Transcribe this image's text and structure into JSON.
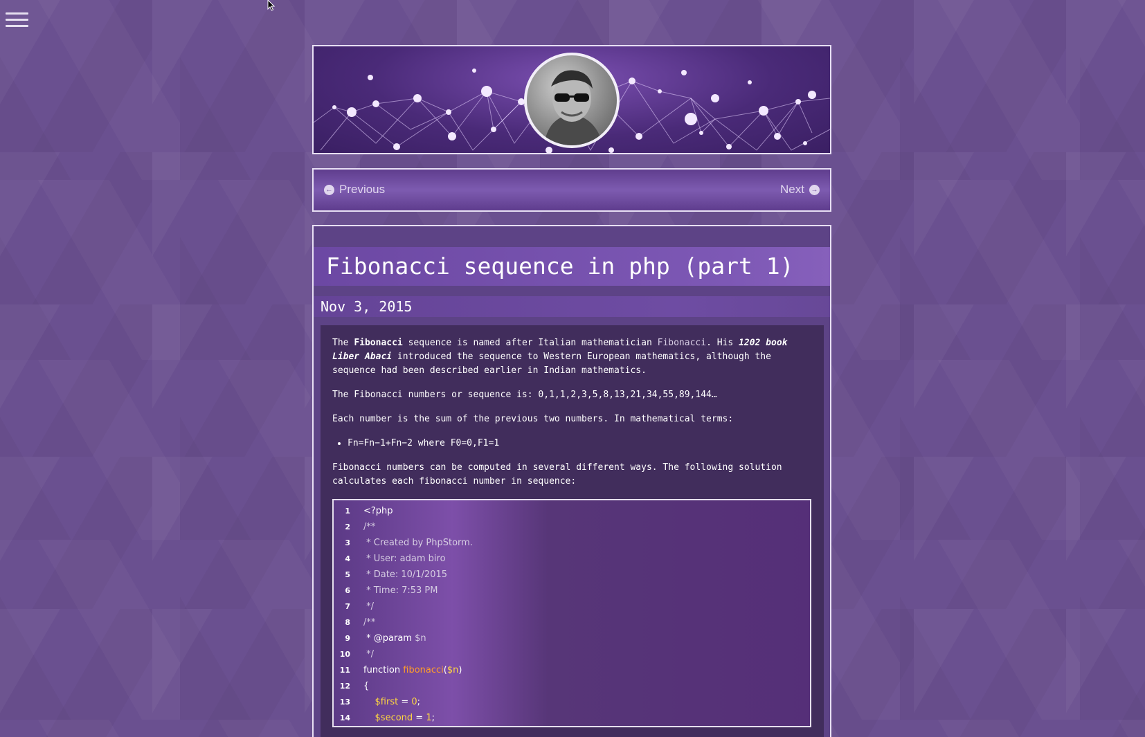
{
  "menu": {
    "icon": "hamburger-menu-icon"
  },
  "header": {
    "avatar": "author-avatar"
  },
  "nav": {
    "previous": "Previous",
    "next": "Next"
  },
  "post": {
    "title": "Fibonacci sequence in php (part 1)",
    "date": "Nov 3, 2015",
    "p1": {
      "a": "The ",
      "b": "Fibonacci",
      "c": " sequence is named after Italian mathematician ",
      "d": "Fibonacci",
      "e": ". His ",
      "f": "1202 book Liber Abaci",
      "g": " introduced the sequence to Western European mathematics, although the sequence had been described earlier in Indian mathematics."
    },
    "p2": "The Fibonacci numbers or sequence is: 0,1,1,2,3,5,8,13,21,34,55,89,144…",
    "p3": "Each number is the sum of the previous two numbers. In mathematical terms:",
    "bullet": "Fn=Fn−1+Fn−2 where F0=0,F1=1",
    "p4": "Fibonacci numbers can be computed in several different ways. The following solution calculates each fibonacci number in sequence:"
  },
  "code": {
    "lines": [
      {
        "n": "1",
        "t": "<?php"
      },
      {
        "n": "2",
        "t": "/**"
      },
      {
        "n": "3",
        "t": " * Created by PhpStorm."
      },
      {
        "n": "4",
        "t": " * User: adam biro"
      },
      {
        "n": "5",
        "t": " * Date: 10/1/2015"
      },
      {
        "n": "6",
        "t": " * Time: 7:53 PM"
      },
      {
        "n": "7",
        "t": " */"
      },
      {
        "n": "8",
        "t": "/**"
      },
      {
        "n": "9a",
        "t": " * @param"
      },
      {
        "n": "9b",
        "t": " $n"
      },
      {
        "n": "10",
        "t": " */"
      },
      {
        "n": "11a",
        "t": "function "
      },
      {
        "n": "11b",
        "t": "fibonacci"
      },
      {
        "n": "11c",
        "t": "("
      },
      {
        "n": "11d",
        "t": "$n"
      },
      {
        "n": "11e",
        "t": ")"
      },
      {
        "n": "12",
        "t": "{"
      },
      {
        "n": "13a",
        "t": "    $first"
      },
      {
        "n": "13b",
        "t": " = "
      },
      {
        "n": "13c",
        "t": "0"
      },
      {
        "n": "13d",
        "t": ";"
      },
      {
        "n": "14a",
        "t": "    $second"
      },
      {
        "n": "14b",
        "t": " = "
      },
      {
        "n": "14c",
        "t": "1"
      },
      {
        "n": "14d",
        "t": ";"
      }
    ],
    "numbers": [
      "1",
      "2",
      "3",
      "4",
      "5",
      "6",
      "7",
      "8",
      "9",
      "10",
      "11",
      "12",
      "13",
      "14"
    ]
  }
}
